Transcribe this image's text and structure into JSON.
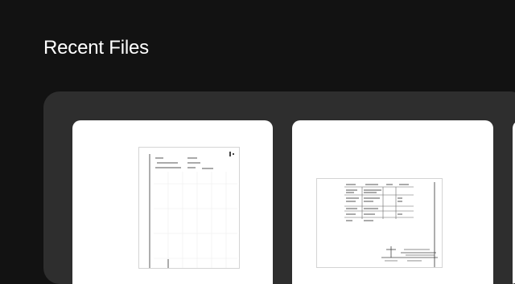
{
  "recent_files": {
    "heading": "Recent Files"
  },
  "colors": {
    "page_background": "#121212",
    "panel_background": "#2e2e2e",
    "card_background": "#ffffff"
  }
}
